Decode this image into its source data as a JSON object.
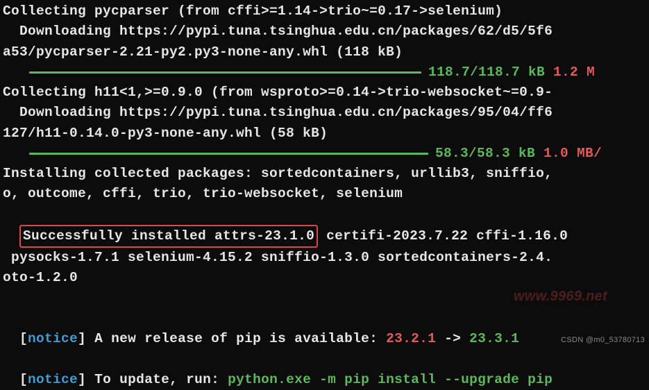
{
  "lines": {
    "l1": "Collecting pycparser (from cffi>=1.14->trio~=0.17->selenium)",
    "l2a": "  Downloading https://pypi.tuna.tsinghua.edu.cn/packages/62/d5/5f6",
    "l2b": "a53/pycparser-2.21-py2.py3-none-any.whl (118 kB)",
    "bar1_done": "118.7/118.7 kB",
    "bar1_speed": " 1.2 M",
    "l4": "Collecting h11<1,>=0.9.0 (from wsproto>=0.14->trio-websocket~=0.9-",
    "l5a": "  Downloading https://pypi.tuna.tsinghua.edu.cn/packages/95/04/ff6",
    "l5b": "127/h11-0.14.0-py3-none-any.whl (58 kB)",
    "bar2_done": "58.3/58.3 kB",
    "bar2_speed": " 1.0 MB/",
    "l7": "Installing collected packages: sortedcontainers, urllib3, sniffio,",
    "l8": "o, outcome, cffi, trio, trio-websocket, selenium",
    "l9_hl": "Successfully installed attrs-23.1.0",
    "l9_rest": " certifi-2023.7.22 cffi-1.16.0",
    "l10": " pysocks-1.7.1 selenium-4.15.2 sniffio-1.3.0 sortedcontainers-2.4.",
    "l11": "oto-1.2.0",
    "notice_open": "[",
    "notice_word": "notice",
    "notice_close": "] ",
    "n1_text": "A new release of pip is available: ",
    "n1_old": "23.2.1",
    "n1_arrow": " -> ",
    "n1_new": "23.3.1",
    "n2_text": "To update, run: ",
    "n2_cmd": "python.exe -m pip install --upgrade pip"
  },
  "watermarks": {
    "w1": "www.9969.net",
    "w2": "CSDN @m0_53780713"
  }
}
